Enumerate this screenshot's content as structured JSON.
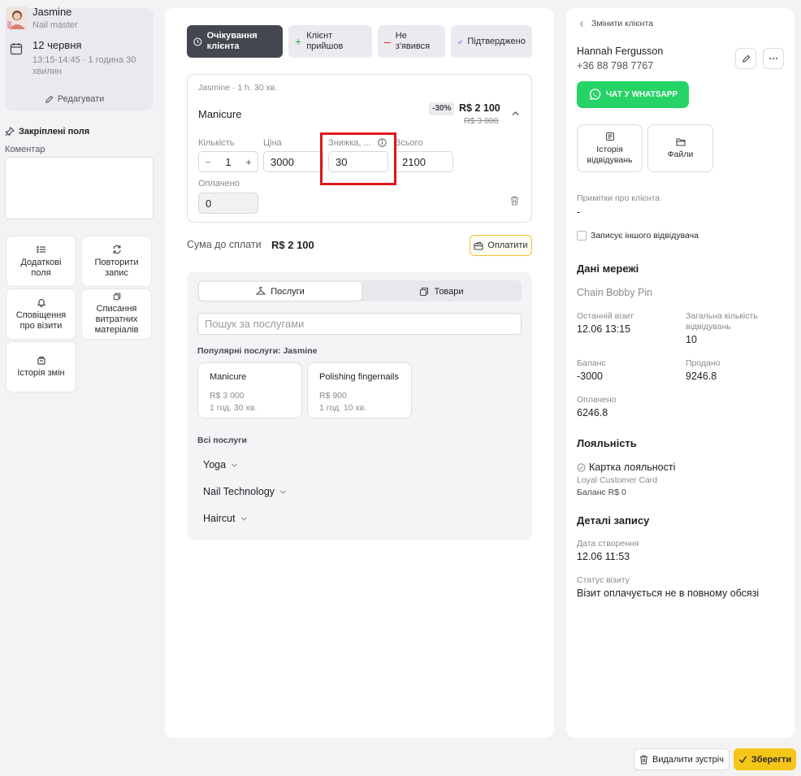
{
  "staff": {
    "name": "Jasmine",
    "role": "Nail master",
    "date": "12 червня",
    "time": "13:15-14:45 · 1 година 30 хвилин",
    "edit_label": "Редагувати"
  },
  "pinned_fields_label": "Закріплені поля",
  "comment_label": "Коментар",
  "tiles": {
    "additional_fields": "Додаткові поля",
    "repeat_booking": "Повторити запис",
    "visit_notifications": "Сповіщення про візити",
    "writeoff_materials": "Списання витратних матеріалів",
    "change_history": "Історія змін"
  },
  "statuses": {
    "waiting": "Очікування клієнта",
    "arrived": "Клієнт прийшов",
    "no_show": "Не з'явився",
    "confirmed": "Підтверджено"
  },
  "service": {
    "meta": "Jasmine · 1 h. 30 хв.",
    "name": "Manicure",
    "discount_badge": "-30%",
    "price": "R$ 2 100",
    "old_price": "R$ 3 000",
    "qty_label": "Кількість",
    "qty": "1",
    "price_label": "Ціна",
    "price_value": "3000",
    "discount_label": "Знижка, ...",
    "discount_value": "30",
    "total_label": "Всього",
    "total_value": "2100",
    "paid_label": "Оплачено",
    "paid_value": "0"
  },
  "amount_due_label": "Сума до сплати",
  "amount_due": "R$ 2 100",
  "pay_label": "Оплатити",
  "catalog": {
    "tab_services": "Послуги",
    "tab_goods": "Товари",
    "search_placeholder": "Пошук за послугами",
    "popular_label": "Популярні послуги: Jasmine",
    "popular": [
      {
        "name": "Manicure",
        "price": "R$ 3 000",
        "duration": "1 год. 30 хв."
      },
      {
        "name": "Polishing fingernails",
        "price": "R$ 900",
        "duration": "1 год. 10 хв."
      }
    ],
    "all_label": "Всі послуги",
    "categories": [
      "Yoga",
      "Nail Technology",
      "Haircut"
    ]
  },
  "client": {
    "change_label": "Змінити клієнта",
    "name": "Hannah Fergusson",
    "phone": "+36 88 798 7767",
    "whatsapp_label": "ЧАТ У WHATSAPP",
    "history_label": "Історія відвідувань",
    "files_label": "Файли",
    "notes_label": "Примітки про клієнта",
    "notes_value": "-",
    "other_visitor_label": "Записує іншого відвідувача"
  },
  "network": {
    "title": "Дані мережі",
    "chain": "Chain Bobby Pin",
    "last_visit_label": "Останній візит",
    "last_visit": "12.06 13:15",
    "total_visits_label": "Загальна кількість відвідувань",
    "total_visits": "10",
    "balance_label": "Баланс",
    "balance": "-3000",
    "sold_label": "Продано",
    "sold": "9246.8",
    "paid_label": "Оплачено",
    "paid": "6246.8"
  },
  "loyalty": {
    "title": "Лояльність",
    "card_label": "Картка лояльності",
    "card_name": "Loyal Customer Card",
    "card_balance": "Баланс R$ 0"
  },
  "booking": {
    "title": "Деталі запису",
    "created_label": "Дата створення",
    "created": "12.06 11:53",
    "status_label": "Статус візиту",
    "status": "Візит оплачується не в повному обсязі"
  },
  "footer": {
    "delete_label": "Видалити зустріч",
    "save_label": "Зберегти"
  },
  "colors": {
    "accent_yellow": "#f5c518",
    "whatsapp_green": "#25d366",
    "active_status": "#44474f",
    "highlight_red": "#e0141b"
  }
}
